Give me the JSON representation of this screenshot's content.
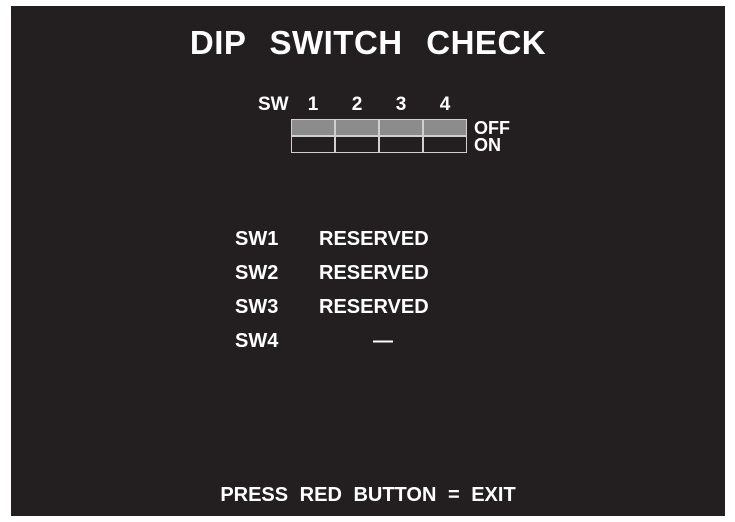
{
  "title": "DIP SWITCH CHECK",
  "switch_header": {
    "label": "SW",
    "numbers": [
      "1",
      "2",
      "3",
      "4"
    ]
  },
  "switch_states": {
    "off_label": "OFF",
    "on_label": "ON",
    "positions": [
      "OFF",
      "OFF",
      "OFF",
      "OFF"
    ]
  },
  "settings": [
    {
      "switch": "SW1",
      "value": "RESERVED"
    },
    {
      "switch": "SW2",
      "value": "RESERVED"
    },
    {
      "switch": "SW3",
      "value": "RESERVED"
    },
    {
      "switch": "SW4",
      "value": "—"
    }
  ],
  "footer": "PRESS RED BUTTON = EXIT",
  "colors": {
    "background": "#231f20",
    "text": "#ffffff",
    "switch_off_fill": "#8c8c8c"
  }
}
